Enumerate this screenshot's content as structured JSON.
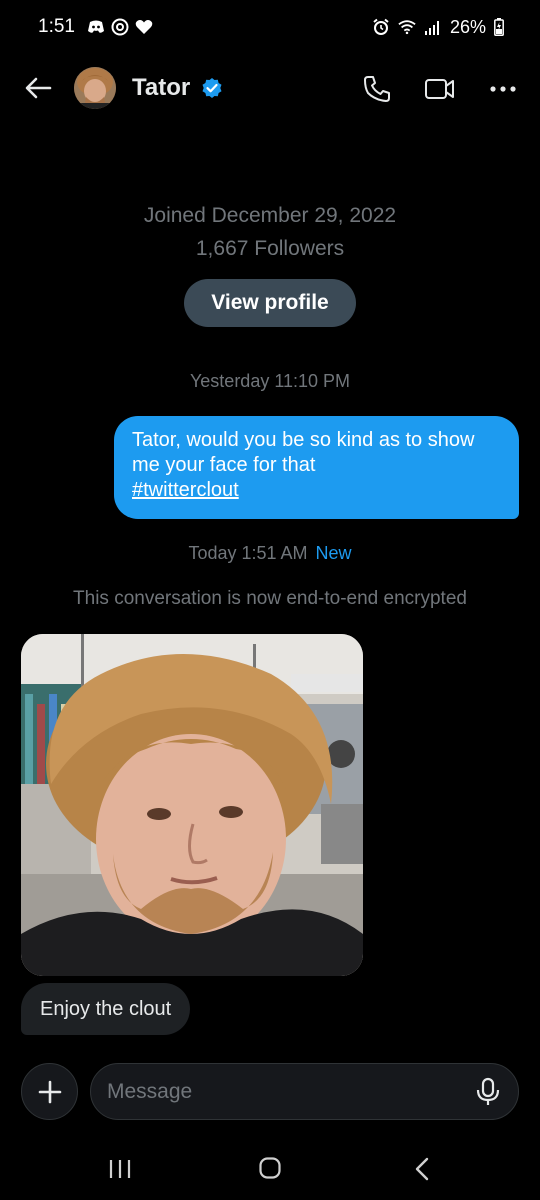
{
  "status_bar": {
    "time": "1:51",
    "battery": "26%"
  },
  "header": {
    "name": "Tator"
  },
  "profile": {
    "joined": "Joined December 29, 2022",
    "followers": "1,667 Followers",
    "view_profile_label": "View profile"
  },
  "messages": {
    "timestamp_1": "Yesterday 11:10 PM",
    "outgoing_text": "Tator, would you be so kind as to show me your face for that",
    "outgoing_hashtag": "#twitterclout",
    "timestamp_2": "Today 1:51 AM",
    "new_label": "New",
    "encryption_notice": "This conversation is now end-to-end encrypted",
    "incoming_text": "Enjoy the clout"
  },
  "composer": {
    "placeholder": "Message"
  },
  "colors": {
    "accent": "#1d9bf0",
    "background": "#000000",
    "muted_text": "#71767b",
    "incoming_bubble": "#1e2124",
    "view_profile_button": "#3b4a56"
  },
  "icons": [
    "discord-icon",
    "threads-icon",
    "heart-icon",
    "alarm-icon",
    "wifi-icon",
    "signal-icon",
    "battery-icon",
    "back-arrow-icon",
    "verified-badge-icon",
    "phone-icon",
    "video-camera-icon",
    "more-icon",
    "plus-icon",
    "microphone-icon",
    "recent-apps-icon",
    "home-icon",
    "nav-back-icon"
  ]
}
